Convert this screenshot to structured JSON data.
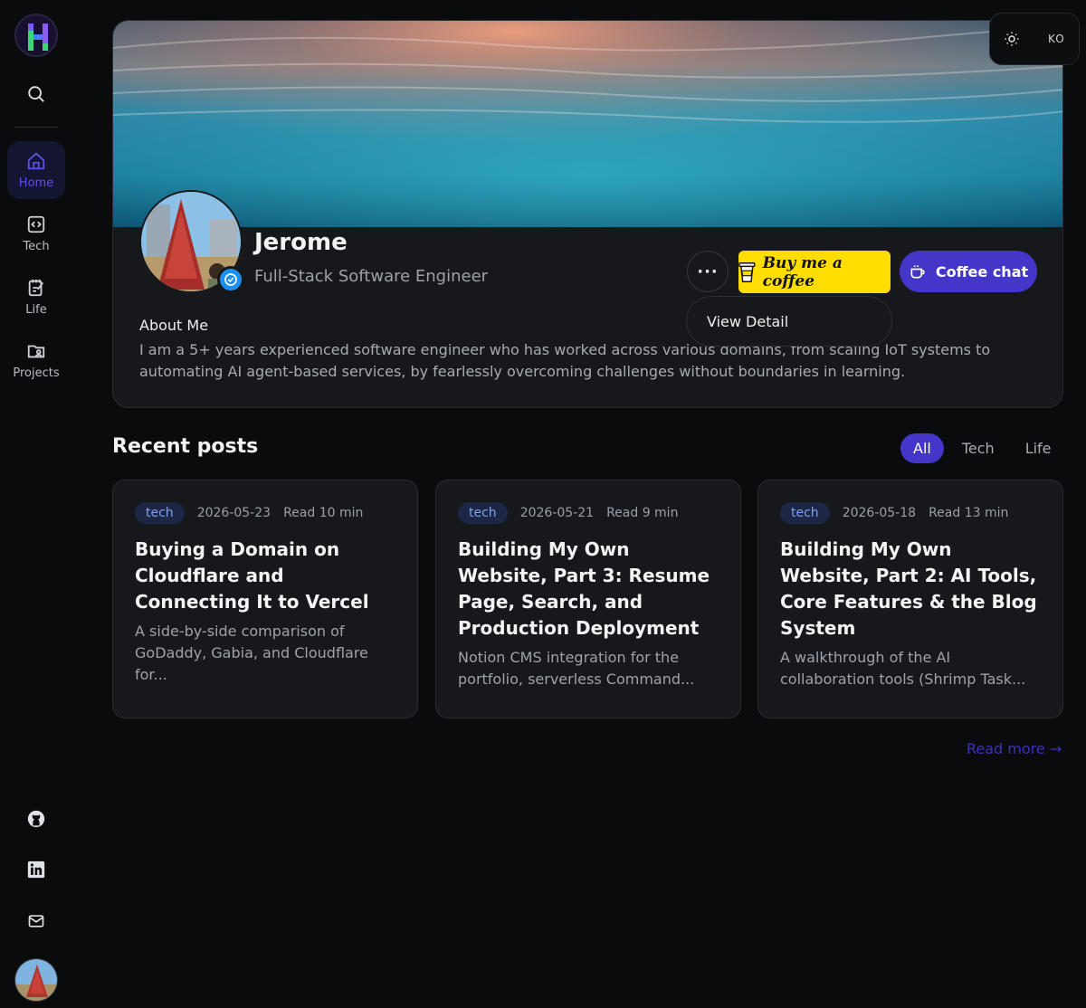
{
  "sidebar": {
    "search_icon": "search-icon",
    "nav": [
      {
        "label": "Home",
        "icon": "home-icon",
        "active": true
      },
      {
        "label": "Tech",
        "icon": "code-icon",
        "active": false
      },
      {
        "label": "Life",
        "icon": "notebook-icon",
        "active": false
      },
      {
        "label": "Projects",
        "icon": "folder-user-icon",
        "active": false
      }
    ],
    "social": [
      "github-icon",
      "linkedin-icon",
      "mail-icon"
    ]
  },
  "topbar": {
    "theme_icon": "sun-icon",
    "lang": "KO"
  },
  "profile": {
    "name": "Jerome",
    "role": "Full-Stack Software Engineer",
    "more_label": "···",
    "bmc_label": "Buy me a coffee",
    "coffee_chat_label": "Coffee chat",
    "dropdown_item": "View Detail",
    "about_title": "About Me",
    "about_text": "I am a 5+ years experienced software engineer who has worked across various domains, from scaling IoT systems to automating AI agent-based services, by fearlessly overcoming challenges without boundaries in learning."
  },
  "posts": {
    "title": "Recent posts",
    "filters": [
      "All",
      "Tech",
      "Life"
    ],
    "active_filter": "All",
    "items": [
      {
        "tag": "tech",
        "date": "2026-05-23",
        "read": "Read 10 min",
        "title": "Buying a Domain on Cloudflare and Connecting It to Vercel",
        "desc": "A side-by-side comparison of\nGoDaddy, Gabia, and Cloudflare for..."
      },
      {
        "tag": "tech",
        "date": "2026-05-21",
        "read": "Read 9 min",
        "title": "Building My Own Website, Part 3: Resume Page, Search, and Production Deployment",
        "desc": "Notion CMS integration for the\nportfolio, serverless Command..."
      },
      {
        "tag": "tech",
        "date": "2026-05-18",
        "read": "Read 13 min",
        "title": "Building My Own Website, Part 2: AI Tools, Core Features & the Blog System",
        "desc": "A walkthrough of the AI\ncollaboration tools (Shrimp Task..."
      }
    ],
    "read_more": "Read more →"
  },
  "colors": {
    "accent": "#4336c9",
    "bmc_yellow": "#ffdd00",
    "background": "#0a0b0c"
  }
}
